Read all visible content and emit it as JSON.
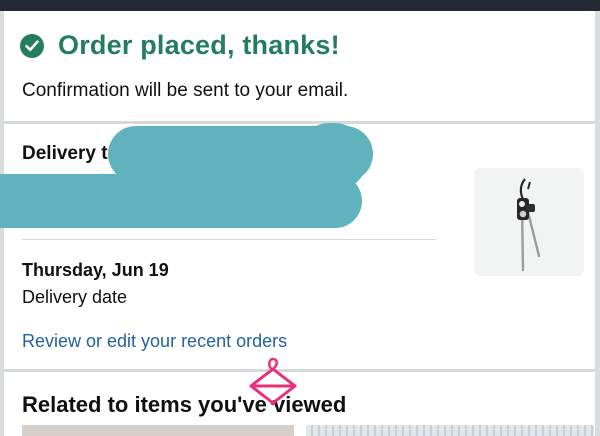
{
  "confirmation": {
    "title": "Order placed, thanks!",
    "subtitle": "Confirmation will be sent to your email."
  },
  "delivery": {
    "heading": "Delivery to",
    "day": "Thursday, Jun 19",
    "label": "Delivery date"
  },
  "links": {
    "review_orders": "Review or edit your recent orders"
  },
  "related": {
    "heading": "Related to items you've viewed"
  },
  "icons": {
    "check": "check-circle-icon",
    "overlay": "hanger-icon"
  },
  "colors": {
    "success": "#257e5b",
    "link": "#2162a1",
    "redaction": "#60b3bc",
    "overlay": "#e8317a"
  }
}
